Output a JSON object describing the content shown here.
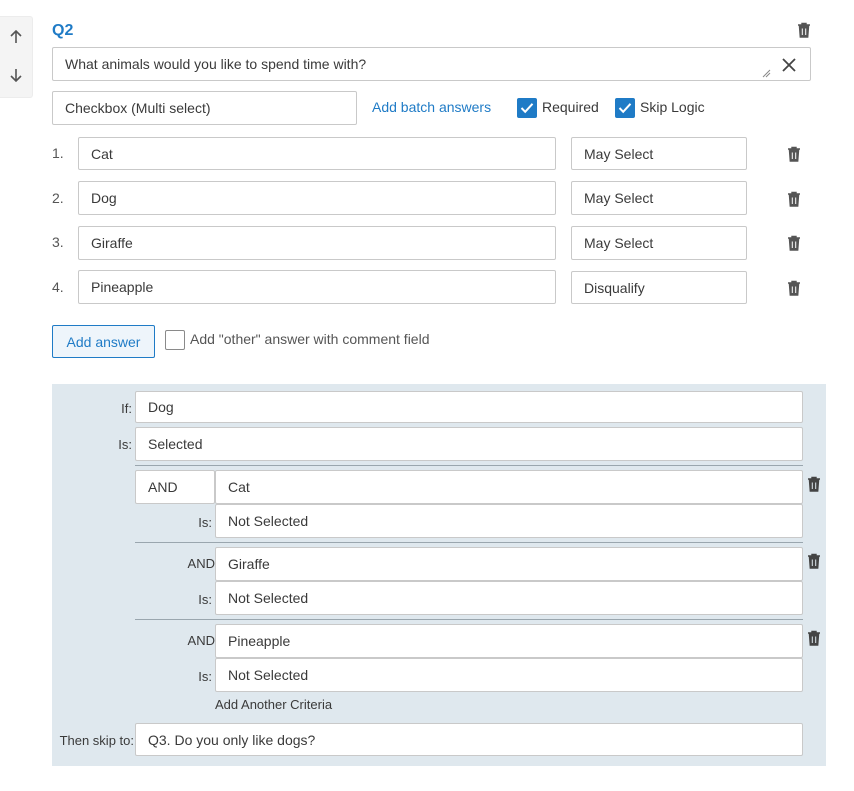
{
  "question": {
    "number": "Q2",
    "text": "What animals would you like to spend time with?",
    "type": "Checkbox (Multi select)",
    "add_batch_label": "Add batch answers",
    "required_label": "Required",
    "required_checked": true,
    "skip_logic_label": "Skip Logic",
    "skip_logic_checked": true
  },
  "answers": [
    {
      "index": "1.",
      "text": "Cat",
      "action": "May Select"
    },
    {
      "index": "2.",
      "text": "Dog",
      "action": "May Select"
    },
    {
      "index": "3.",
      "text": "Giraffe",
      "action": "May Select"
    },
    {
      "index": "4.",
      "text": "Pineapple",
      "action": "Disqualify"
    }
  ],
  "add_answer_label": "Add answer",
  "other_answer_label": "Add \"other\" answer with comment field",
  "other_answer_checked": false,
  "logic": {
    "if_label": "If:",
    "if_value": "Dog",
    "is_label": "Is:",
    "is_value": "Selected",
    "criteria": [
      {
        "operator": "AND",
        "answer": "Cat",
        "is_label": "Is:",
        "state": "Not Selected"
      },
      {
        "operator": "AND",
        "answer": "Giraffe",
        "is_label": "Is:",
        "state": "Not Selected"
      },
      {
        "operator": "AND",
        "answer": "Pineapple",
        "is_label": "Is:",
        "state": "Not Selected"
      }
    ],
    "add_criteria_label": "Add Another Criteria",
    "then_label": "Then skip to:",
    "then_value": "Q3. Do you only like dogs?"
  },
  "colors": {
    "accent": "#1f7bc6",
    "logic_bg": "#dfe8ee"
  },
  "icons": [
    "arrow-up-icon",
    "arrow-down-icon",
    "trash-icon",
    "close-icon",
    "checkmark-icon",
    "resize-handle-icon"
  ]
}
